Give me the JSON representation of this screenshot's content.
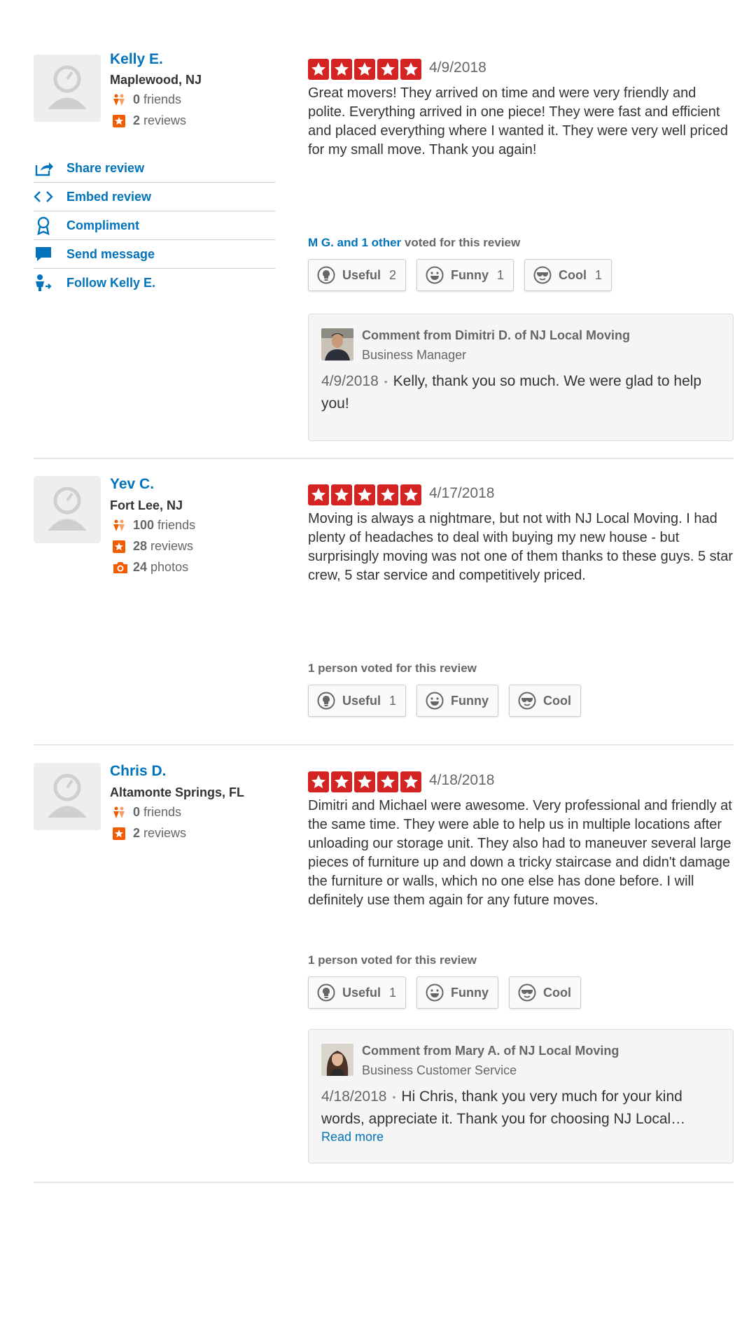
{
  "reviews": [
    {
      "user": {
        "name": "Kelly E.",
        "location": "Maplewood, NJ",
        "friends": "0",
        "friends_label": "friends",
        "reviews": "2",
        "reviews_label": "reviews"
      },
      "actions": [
        {
          "label": "Share review",
          "icon": "share-icon"
        },
        {
          "label": "Embed review",
          "icon": "embed-icon"
        },
        {
          "label": "Compliment",
          "icon": "compliment-icon"
        },
        {
          "label": "Send message",
          "icon": "message-icon"
        },
        {
          "label": "Follow Kelly E.",
          "icon": "follow-icon"
        }
      ],
      "rating": 5,
      "date": "4/9/2018",
      "text": "Great movers! They arrived on time and were very friendly and polite. Everything arrived in one piece! They were fast and efficient and placed everything where I wanted it. They were very well priced for my small move. Thank you again!",
      "voted": {
        "link": "M G. and 1 other",
        "rest": " voted for this review"
      },
      "votes": [
        {
          "label": "Useful",
          "count": "2"
        },
        {
          "label": "Funny",
          "count": "1"
        },
        {
          "label": "Cool",
          "count": "1"
        }
      ],
      "comment": {
        "from": "Comment from Dimitri D. of NJ Local Moving",
        "role": "Business Manager",
        "date": "4/9/2018",
        "dot": "•",
        "text": "Kelly, thank you so much. We were glad to help you!"
      }
    },
    {
      "user": {
        "name": "Yev C.",
        "location": "Fort Lee, NJ",
        "friends": "100",
        "friends_label": "friends",
        "reviews": "28",
        "reviews_label": "reviews",
        "photos": "24",
        "photos_label": "photos"
      },
      "rating": 5,
      "date": "4/17/2018",
      "text": "Moving is always a nightmare, but not with NJ Local Moving. I had plenty of headaches to deal with buying my new house - but surprisingly moving was not one of them thanks to these guys. 5 star crew, 5 star service and competitively priced.",
      "voted": {
        "text": "1 person voted for this review"
      },
      "votes": [
        {
          "label": "Useful",
          "count": "1"
        },
        {
          "label": "Funny",
          "count": ""
        },
        {
          "label": "Cool",
          "count": ""
        }
      ]
    },
    {
      "user": {
        "name": "Chris D.",
        "location": "Altamonte Springs, FL",
        "friends": "0",
        "friends_label": "friends",
        "reviews": "2",
        "reviews_label": "reviews"
      },
      "rating": 5,
      "date": "4/18/2018",
      "text": "Dimitri and Michael were awesome. Very professional and friendly at the same time. They were able to help us in multiple locations after unloading our storage unit. They also had to maneuver several large pieces of furniture up and down a tricky staircase and didn't damage the furniture or walls, which no one else has done before. I will definitely use them again for any future moves.",
      "voted": {
        "text": "1 person voted for this review"
      },
      "votes": [
        {
          "label": "Useful",
          "count": "1"
        },
        {
          "label": "Funny",
          "count": ""
        },
        {
          "label": "Cool",
          "count": ""
        }
      ],
      "comment": {
        "from": "Comment from Mary A. of NJ Local Moving",
        "role": "Business Customer Service",
        "date": "4/18/2018",
        "dot": "•",
        "text": "Hi Chris, thank you very much for your kind words, appreciate it. Thank you for choosing NJ Local…",
        "read_more": "Read more"
      }
    }
  ],
  "colors": {
    "star": "#d32323",
    "link": "#0073bb",
    "stat_icon": "#f15c00"
  }
}
